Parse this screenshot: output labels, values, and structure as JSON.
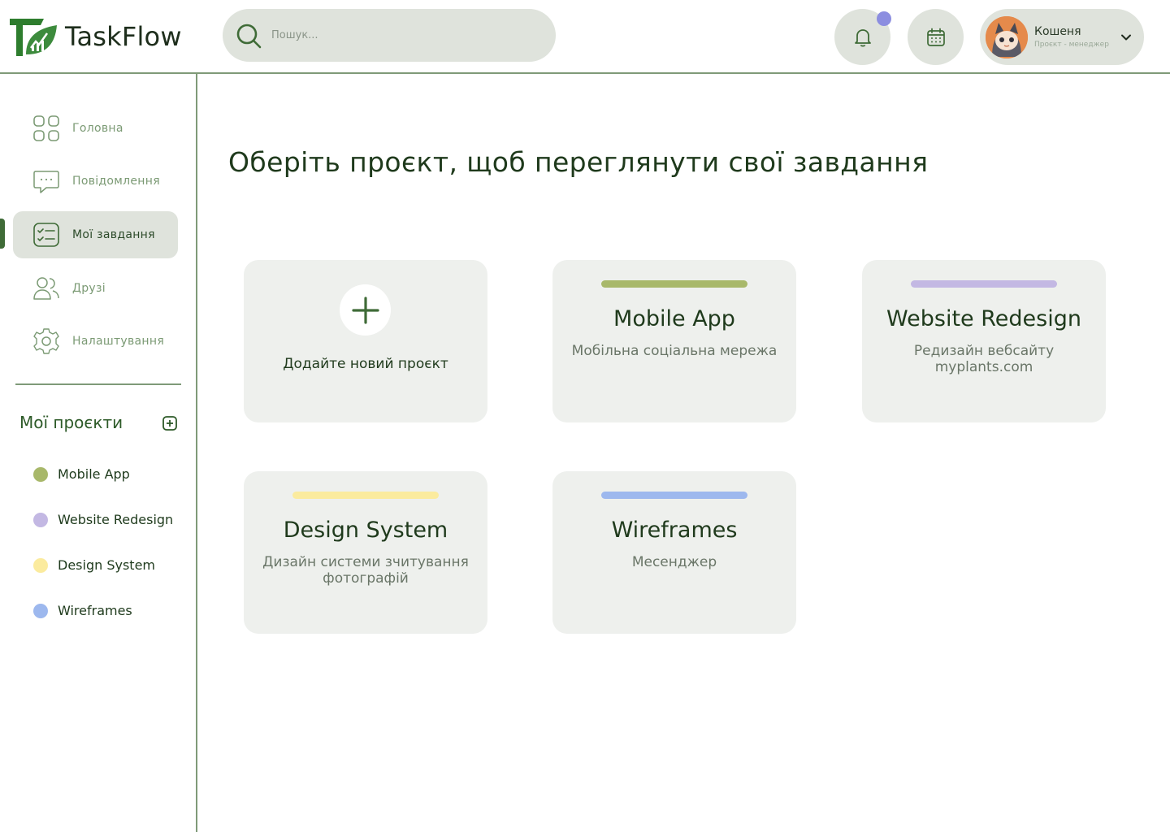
{
  "app": {
    "name": "TaskFlow"
  },
  "search": {
    "placeholder": "Пошук..."
  },
  "user": {
    "name": "Кошеня",
    "role": "Проєкт - менеджер"
  },
  "nav": {
    "items": [
      {
        "label": "Головна",
        "icon": "grid-icon"
      },
      {
        "label": "Повідомлення",
        "icon": "chat-icon"
      },
      {
        "label": "Мої завдання",
        "icon": "checklist-icon",
        "active": true
      },
      {
        "label": "Друзі",
        "icon": "users-icon"
      },
      {
        "label": "Налаштування",
        "icon": "gear-icon"
      }
    ]
  },
  "projects": {
    "title": "Мої проєкти",
    "items": [
      {
        "label": "Mobile App",
        "color": "#a8b86a"
      },
      {
        "label": "Website Redesign",
        "color": "#c3b8e3"
      },
      {
        "label": "Design System",
        "color": "#fbeb9e"
      },
      {
        "label": "Wireframes",
        "color": "#9db8ee"
      }
    ]
  },
  "main": {
    "title": "Оберіть проєкт, щоб переглянути свої завдання",
    "add_card": {
      "label": "Додайте новий проєкт"
    },
    "cards": [
      {
        "title": "Mobile App",
        "subtitle": "Мобільна соціальна мережа",
        "color": "#a8b86a"
      },
      {
        "title": "Website Redesign",
        "subtitle": "Редизайн вебсайту myplants.com",
        "color": "#c3b8e3"
      },
      {
        "title": "Design System",
        "subtitle": "Дизайн системи зчитування фотографій",
        "color": "#fbeb9e"
      },
      {
        "title": "Wireframes",
        "subtitle": "Месенджер",
        "color": "#9db8ee"
      }
    ]
  },
  "colors": {
    "accent": "#3f6b37",
    "panel": "#dfe3dc",
    "card": "#eef0ed",
    "notification": "#8c8ee0"
  }
}
